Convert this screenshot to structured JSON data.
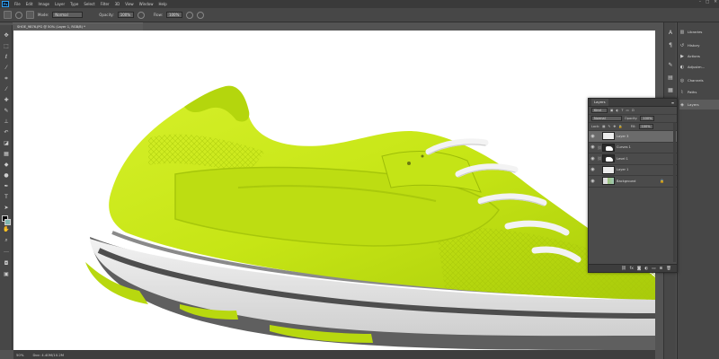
{
  "menu": {
    "app_logo": "Ps",
    "items": [
      "File",
      "Edit",
      "Image",
      "Layer",
      "Type",
      "Select",
      "Filter",
      "3D",
      "View",
      "Window",
      "Help"
    ],
    "window_controls": [
      "–",
      "□",
      "✕"
    ]
  },
  "options_bar": {
    "mode_label": "Mode:",
    "mode_value": "Normal",
    "opacity_label": "Opacity:",
    "opacity_value": "100%",
    "flow_label": "Flow:",
    "flow_value": "100%"
  },
  "document": {
    "tab_title": "SHOE_9876.JPG @ 50% (Layer 1, RGB/8) *"
  },
  "status": {
    "zoom": "50%",
    "doc_info": "Doc: 4.40M/10.2M"
  },
  "right_panels": {
    "items": [
      {
        "label": "Libraries",
        "icon": "libraries-icon"
      },
      {
        "label": "History",
        "icon": "history-icon"
      },
      {
        "label": "Actions",
        "icon": "actions-icon"
      },
      {
        "label": "Adjustm...",
        "icon": "adjustments-icon"
      },
      {
        "label": "Channels",
        "icon": "channels-icon"
      },
      {
        "label": "Paths",
        "icon": "paths-icon"
      },
      {
        "label": "Layers",
        "icon": "layers-icon"
      }
    ]
  },
  "layers_panel": {
    "title": "Layers",
    "filter_label": "Kind",
    "blend_mode": "Normal",
    "opacity_label": "Opacity:",
    "opacity_value": "100%",
    "lock_label": "Lock:",
    "fill_label": "Fill:",
    "fill_value": "100%",
    "layers": [
      {
        "name": "Layer 3",
        "thumb": "white",
        "selected": true,
        "locked": false
      },
      {
        "name": "Curves 1",
        "thumb": "adj",
        "selected": false,
        "locked": false
      },
      {
        "name": "Level 1",
        "thumb": "adj",
        "selected": false,
        "locked": false
      },
      {
        "name": "Layer 1",
        "thumb": "white",
        "selected": false,
        "locked": false
      },
      {
        "name": "Background",
        "thumb": "shoe",
        "selected": false,
        "locked": true
      }
    ]
  },
  "colors": {
    "shoe_green": "#c8ea16",
    "shoe_green_dark": "#9dbd0c",
    "sole_white": "#e6e6e6",
    "sole_grey": "#6e6e6e",
    "lace_white": "#f3f3f3"
  }
}
